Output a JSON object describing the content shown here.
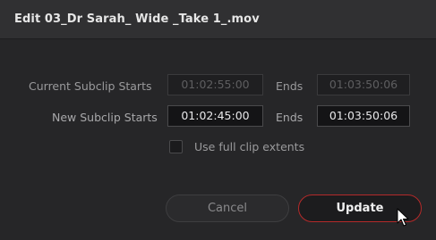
{
  "dialog": {
    "title": "Edit 03_Dr Sarah_ Wide _Take 1_.mov"
  },
  "current_row": {
    "label": "Current Subclip Starts",
    "start_value": "01:02:55:00",
    "ends_label": "Ends",
    "end_value": "01:03:50:06"
  },
  "new_row": {
    "label": "New Subclip Starts",
    "start_value": "01:02:45:00",
    "ends_label": "Ends",
    "end_value": "01:03:50:06"
  },
  "full_extents": {
    "label": "Use full clip extents",
    "checked": false
  },
  "buttons": {
    "cancel_label": "Cancel",
    "update_label": "Update"
  },
  "colors": {
    "update_border": "#b42a2a"
  },
  "icons": {
    "cursor": "mouse-pointer-icon"
  }
}
